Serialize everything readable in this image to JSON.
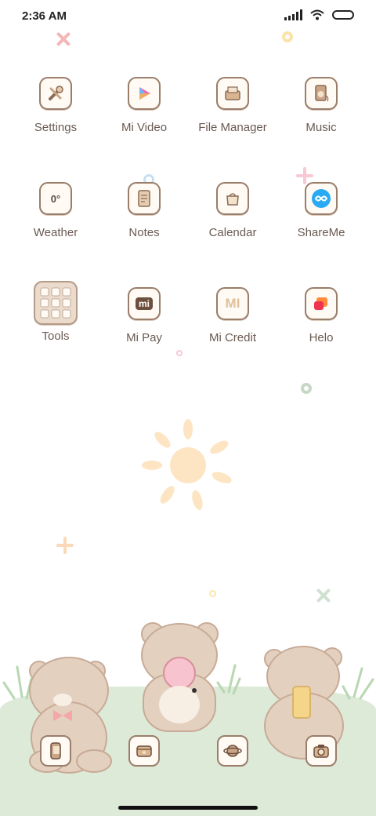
{
  "status_bar": {
    "time": "2:36 AM"
  },
  "apps": [
    {
      "label": "Settings",
      "icon": "settings-icon"
    },
    {
      "label": "Mi Video",
      "icon": "mi-video-icon"
    },
    {
      "label": "File Manager",
      "icon": "file-manager-icon"
    },
    {
      "label": "Music",
      "icon": "music-icon"
    },
    {
      "label": "Weather",
      "icon": "weather-icon",
      "glyph": "0°"
    },
    {
      "label": "Notes",
      "icon": "notes-icon"
    },
    {
      "label": "Calendar",
      "icon": "calendar-icon"
    },
    {
      "label": "ShareMe",
      "icon": "shareme-icon"
    },
    {
      "label": "Tools",
      "icon": "tools-folder-icon"
    },
    {
      "label": "Mi Pay",
      "icon": "mi-pay-icon",
      "glyph": "mi"
    },
    {
      "label": "Mi Credit",
      "icon": "mi-credit-icon",
      "glyph": "MI"
    },
    {
      "label": "Helo",
      "icon": "helo-icon"
    }
  ],
  "dock": [
    {
      "icon": "phone-icon"
    },
    {
      "icon": "messages-icon"
    },
    {
      "icon": "browser-icon"
    },
    {
      "icon": "camera-icon"
    }
  ]
}
